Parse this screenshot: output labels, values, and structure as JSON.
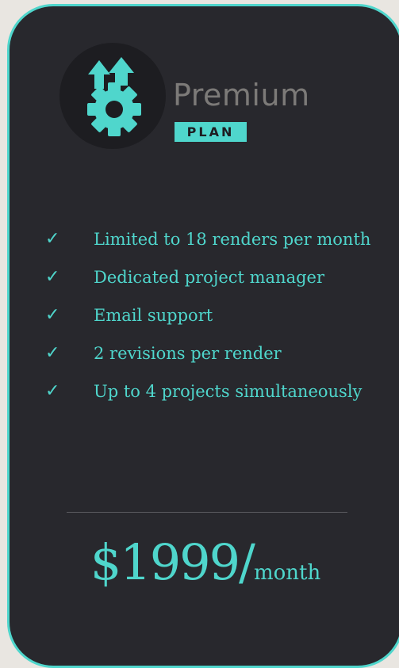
{
  "brand": {
    "name": "Premium",
    "badge": "PLAN"
  },
  "colors": {
    "accent": "#4fd6cc",
    "card_background": "#28282d",
    "page_background": "#e9e6e1",
    "brand_text": "#7c7a78"
  },
  "icons": {
    "logo": "gear-with-up-arrows-icon",
    "feature_marker": "check-icon"
  },
  "features": [
    {
      "check": "✓",
      "text": "Limited to 18 renders per month"
    },
    {
      "check": "✓",
      "text": "Dedicated project manager"
    },
    {
      "check": "✓",
      "text": "Email support"
    },
    {
      "check": "✓",
      "text": "2 revisions per render"
    },
    {
      "check": "✓",
      "text": "Up to 4 projects simultaneously"
    }
  ],
  "price": {
    "amount": "$1999/",
    "period": "month"
  }
}
